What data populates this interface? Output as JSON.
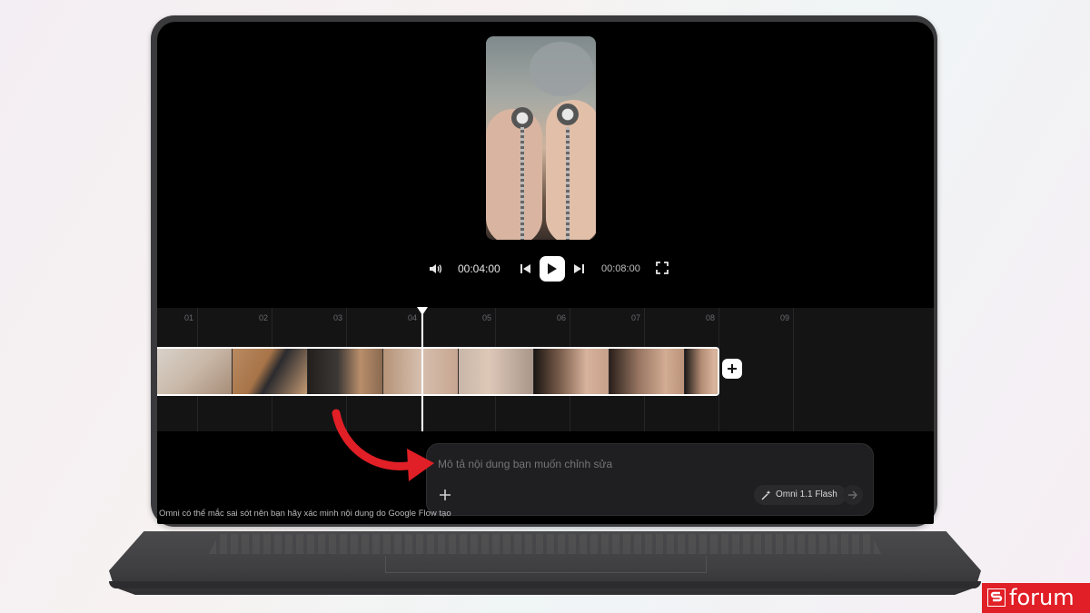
{
  "player": {
    "current_time": "00:04:00",
    "total_time": "00:08:00"
  },
  "timeline": {
    "ticks": [
      "01",
      "02",
      "03",
      "04",
      "05",
      "06",
      "07",
      "08",
      "09"
    ]
  },
  "prompt": {
    "placeholder": "Mô tả nội dung bạn muốn chỉnh sửa",
    "model_label": "Omni 1.1 Flash"
  },
  "disclaimer": "Omni có thể mắc sai sót nên bạn hãy xác minh nội dung do Google Flow tạo",
  "watermark": {
    "text": "forum"
  },
  "colors": {
    "screen_bg": "#000000",
    "timeline_bg": "#141415",
    "arrow": "#e11f26",
    "brand": "#e11f26"
  }
}
